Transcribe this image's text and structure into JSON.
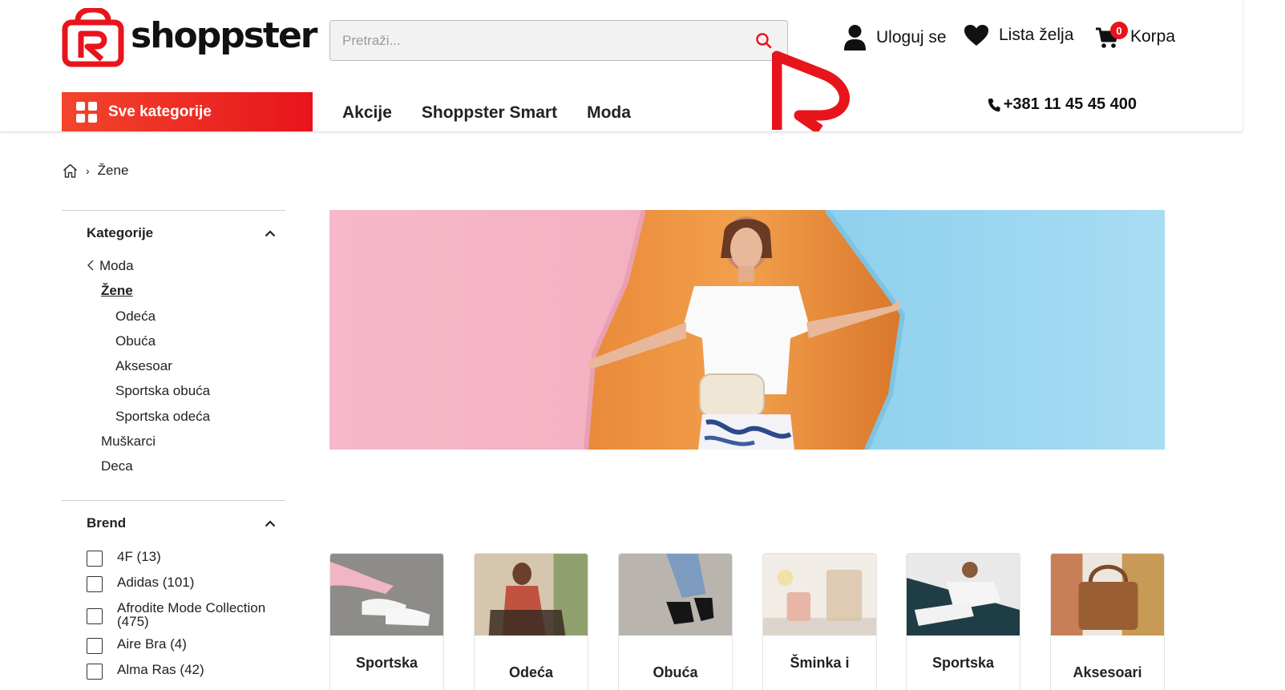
{
  "brand": {
    "name": "shoppster",
    "accent": "#e8141c"
  },
  "search": {
    "placeholder": "Pretraži..."
  },
  "header": {
    "login_label": "Uloguj se",
    "wishlist_label": "Lista želja",
    "cart_label": "Korpa",
    "cart_count": "0",
    "all_categories_label": "Sve kategorije",
    "phone": "+381 11 45 45 400"
  },
  "nav": {
    "items": [
      {
        "label": "Akcije"
      },
      {
        "label": "Shoppster Smart"
      },
      {
        "label": "Moda"
      }
    ]
  },
  "breadcrumb": {
    "current": "Žene"
  },
  "sidebar": {
    "categories_title": "Kategorije",
    "categories": [
      {
        "label": "Moda"
      },
      {
        "label": "Žene"
      },
      {
        "label": "Odeća"
      },
      {
        "label": "Obuća"
      },
      {
        "label": "Aksesoar"
      },
      {
        "label": "Sportska obuća"
      },
      {
        "label": "Sportska odeća"
      },
      {
        "label": "Muškarci"
      },
      {
        "label": "Deca"
      }
    ],
    "brand_title": "Brend",
    "brands": [
      {
        "label": "4F (13)"
      },
      {
        "label": "Adidas (101)"
      },
      {
        "label": "Afrodite Mode Collection (475)"
      },
      {
        "label": "Aire Bra (4)"
      },
      {
        "label": "Alma Ras (42)"
      }
    ]
  },
  "category_cards": [
    {
      "title": "Sportska"
    },
    {
      "title": "Odeća"
    },
    {
      "title": "Obuća"
    },
    {
      "title": "Šminka i"
    },
    {
      "title": "Sportska"
    },
    {
      "title": "Aksesoari"
    }
  ]
}
